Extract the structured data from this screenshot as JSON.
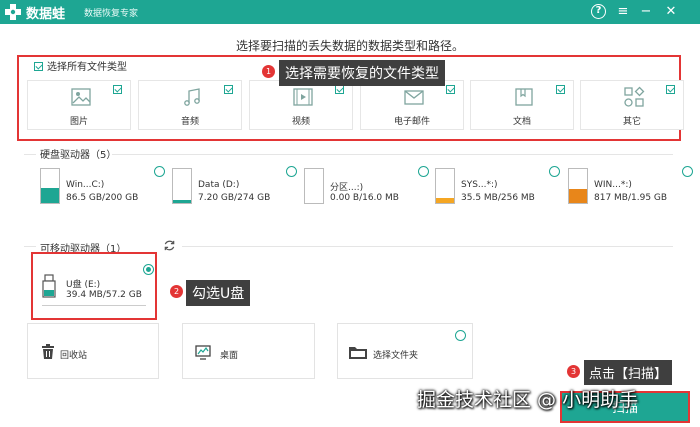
{
  "app": {
    "name": "数据蛙",
    "subtitle": "数据恢复专家"
  },
  "heading": "选择要扫描的丢失数据的数据类型和路径。",
  "file_types": {
    "select_all_label": "选择所有文件类型",
    "items": [
      {
        "label": "图片",
        "checked": true,
        "icon": "image-icon"
      },
      {
        "label": "音频",
        "checked": true,
        "icon": "music-icon"
      },
      {
        "label": "视频",
        "checked": true,
        "icon": "video-icon"
      },
      {
        "label": "电子邮件",
        "checked": true,
        "icon": "mail-icon"
      },
      {
        "label": "文档",
        "checked": true,
        "icon": "document-icon"
      },
      {
        "label": "其它",
        "checked": true,
        "icon": "other-icon"
      }
    ]
  },
  "callouts": {
    "c1": {
      "num": "1",
      "text": "选择需要恢复的文件类型"
    },
    "c2": {
      "num": "2",
      "text": "勾选U盘"
    },
    "c3": {
      "num": "3",
      "text": "点击【扫描】"
    }
  },
  "hard_drives": {
    "title": "硬盘驱动器（5）",
    "items": [
      {
        "name": "Win...C:)",
        "size": "86.5 GB/200 GB",
        "used_fraction": 0.43,
        "color": "#1ea693"
      },
      {
        "name": "Data (D:)",
        "size": "7.20 GB/274 GB",
        "used_fraction": 0.03,
        "color": "#1ea693"
      },
      {
        "name": "分区...:)",
        "size": "0.00  B/16.0 MB",
        "used_fraction": 0.0,
        "color": "#f5a623"
      },
      {
        "name": "SYS...*:)",
        "size": "35.5 MB/256 MB",
        "used_fraction": 0.14,
        "color": "#f5a623"
      },
      {
        "name": "WIN...*:)",
        "size": "817 MB/1.95 GB",
        "used_fraction": 0.42,
        "color": "#e8861a"
      }
    ]
  },
  "removable": {
    "title": "可移动驱动器（1）",
    "items": [
      {
        "name": "U盘 (E:)",
        "size": "39.4 MB/57.2 GB",
        "selected": true
      }
    ]
  },
  "locations": [
    {
      "label": "回收站",
      "icon": "recycle-bin-icon"
    },
    {
      "label": "桌面",
      "icon": "desktop-icon"
    },
    {
      "label": "选择文件夹",
      "icon": "folder-icon"
    }
  ],
  "scan_button": "扫描",
  "watermark": "掘金技术社区 @ 小明助手",
  "colors": {
    "accent": "#1ea693",
    "highlight": "#e33535",
    "callout_bg": "#3f3f3f"
  }
}
